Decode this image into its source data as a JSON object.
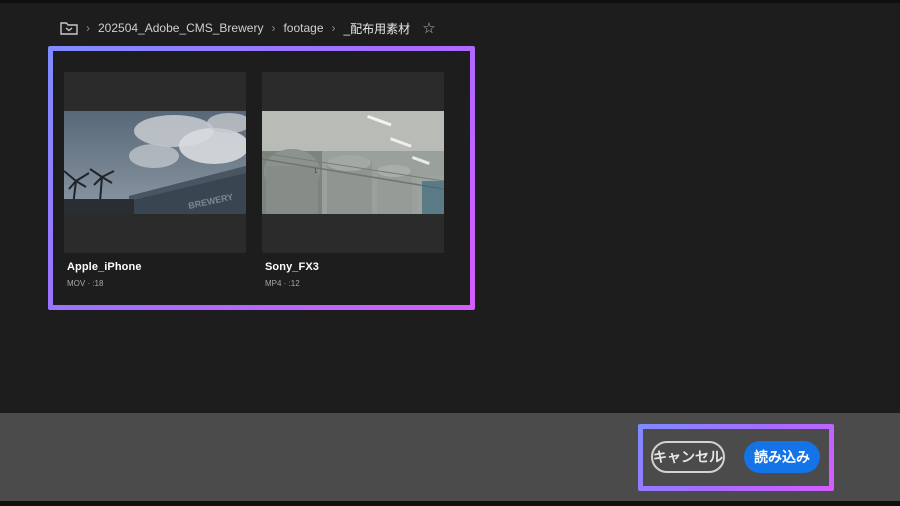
{
  "breadcrumb": {
    "icon": "folder-icon",
    "items": [
      "202504_Adobe_CMS_Brewery",
      "footage",
      "_配布用素材"
    ],
    "favorite_icon": "star-outline-icon"
  },
  "media": [
    {
      "title": "Apple_iPhone",
      "meta": "MOV · :18",
      "thumbnail": "sky-clouds-palm-building-thumbnail"
    },
    {
      "title": "Sony_FX3",
      "meta": "MP4 · :12",
      "thumbnail": "brewery-tanks-thumbnail"
    }
  ],
  "footer": {
    "cancel_label": "キャンセル",
    "import_label": "読み込み"
  },
  "colors": {
    "background": "#1d1d1d",
    "footer": "#4b4b4b",
    "primary_button": "#1473e6",
    "highlight_start": "#7f8cff",
    "highlight_end": "#d65cff"
  }
}
